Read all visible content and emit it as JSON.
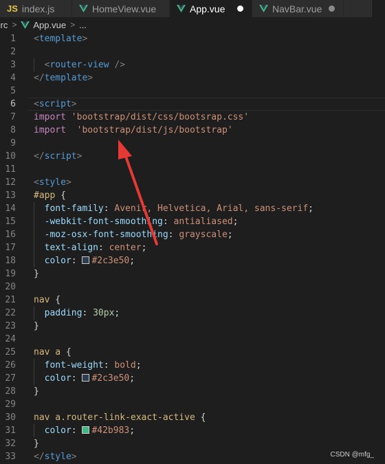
{
  "tabs": [
    {
      "label": "index.js",
      "icon": "js-icon",
      "state": "normal"
    },
    {
      "label": "HomeView.vue",
      "icon": "vue-icon",
      "state": "normal"
    },
    {
      "label": "App.vue",
      "icon": "vue-icon",
      "state": "active-modified"
    },
    {
      "label": "NavBar.vue",
      "icon": "vue-icon",
      "state": "modified"
    }
  ],
  "breadcrumb": {
    "folder": "src",
    "file": "App.vue",
    "symbol": "..."
  },
  "editor": {
    "current_line": 6,
    "lines": [
      {
        "n": "1",
        "tokens": [
          [
            "t-bracket",
            "<"
          ],
          [
            "t-tag",
            "template"
          ],
          [
            "t-bracket",
            ">"
          ]
        ]
      },
      {
        "n": "2",
        "tokens": []
      },
      {
        "n": "3",
        "tokens": [
          [
            "t-punc",
            "  "
          ],
          [
            "t-bracket",
            "<"
          ],
          [
            "t-tag",
            "router-view"
          ],
          [
            "t-bracket",
            " />"
          ]
        ]
      },
      {
        "n": "4",
        "tokens": [
          [
            "t-bracket",
            "</"
          ],
          [
            "t-tag",
            "template"
          ],
          [
            "t-bracket",
            ">"
          ]
        ]
      },
      {
        "n": "5",
        "tokens": []
      },
      {
        "n": "6",
        "tokens": [
          [
            "t-bracket",
            "<"
          ],
          [
            "t-tag",
            "script"
          ],
          [
            "t-bracket",
            ">"
          ]
        ]
      },
      {
        "n": "7",
        "tokens": [
          [
            "t-kw",
            "import"
          ],
          [
            "t-punc",
            " "
          ],
          [
            "t-str",
            "'bootstrap/dist/css/bootsrap.css'"
          ]
        ]
      },
      {
        "n": "8",
        "tokens": [
          [
            "t-kw",
            "import"
          ],
          [
            "t-punc",
            "  "
          ],
          [
            "t-str",
            "'bootstrap/dist/js/bootstrap'"
          ]
        ]
      },
      {
        "n": "9",
        "tokens": []
      },
      {
        "n": "10",
        "tokens": [
          [
            "t-bracket",
            "</"
          ],
          [
            "t-tag",
            "script"
          ],
          [
            "t-bracket",
            ">"
          ]
        ]
      },
      {
        "n": "11",
        "tokens": []
      },
      {
        "n": "12",
        "tokens": [
          [
            "t-bracket",
            "<"
          ],
          [
            "t-tag",
            "style"
          ],
          [
            "t-bracket",
            ">"
          ]
        ]
      },
      {
        "n": "13",
        "tokens": [
          [
            "t-sel",
            "#app"
          ],
          [
            "t-punc",
            " {"
          ]
        ]
      },
      {
        "n": "14",
        "tokens": [
          [
            "t-punc",
            "  "
          ],
          [
            "t-prop",
            "font-family"
          ],
          [
            "t-punc",
            ": "
          ],
          [
            "t-val",
            "Avenir, Helvetica, Arial, sans-serif"
          ],
          [
            "t-punc",
            ";"
          ]
        ]
      },
      {
        "n": "15",
        "tokens": [
          [
            "t-punc",
            "  "
          ],
          [
            "t-prop",
            "-webkit-font-smoothing"
          ],
          [
            "t-punc",
            ": "
          ],
          [
            "t-val",
            "antialiased"
          ],
          [
            "t-punc",
            ";"
          ]
        ]
      },
      {
        "n": "16",
        "tokens": [
          [
            "t-punc",
            "  "
          ],
          [
            "t-prop",
            "-moz-osx-font-smoothing"
          ],
          [
            "t-punc",
            ": "
          ],
          [
            "t-val",
            "grayscale"
          ],
          [
            "t-punc",
            ";"
          ]
        ]
      },
      {
        "n": "17",
        "tokens": [
          [
            "t-punc",
            "  "
          ],
          [
            "t-prop",
            "text-align"
          ],
          [
            "t-punc",
            ": "
          ],
          [
            "t-val",
            "center"
          ],
          [
            "t-punc",
            ";"
          ]
        ]
      },
      {
        "n": "18",
        "tokens": [
          [
            "t-punc",
            "  "
          ],
          [
            "t-prop",
            "color"
          ],
          [
            "t-punc",
            ": "
          ],
          [
            "swatch",
            "#2c3e50"
          ],
          [
            "t-val",
            "#2c3e50"
          ],
          [
            "t-punc",
            ";"
          ]
        ]
      },
      {
        "n": "19",
        "tokens": [
          [
            "t-punc",
            "}"
          ]
        ]
      },
      {
        "n": "20",
        "tokens": []
      },
      {
        "n": "21",
        "tokens": [
          [
            "t-sel",
            "nav"
          ],
          [
            "t-punc",
            " {"
          ]
        ]
      },
      {
        "n": "22",
        "tokens": [
          [
            "t-punc",
            "  "
          ],
          [
            "t-prop",
            "padding"
          ],
          [
            "t-punc",
            ": "
          ],
          [
            "t-num",
            "30px"
          ],
          [
            "t-punc",
            ";"
          ]
        ]
      },
      {
        "n": "23",
        "tokens": [
          [
            "t-punc",
            "}"
          ]
        ]
      },
      {
        "n": "24",
        "tokens": []
      },
      {
        "n": "25",
        "tokens": [
          [
            "t-sel",
            "nav a"
          ],
          [
            "t-punc",
            " {"
          ]
        ]
      },
      {
        "n": "26",
        "tokens": [
          [
            "t-punc",
            "  "
          ],
          [
            "t-prop",
            "font-weight"
          ],
          [
            "t-punc",
            ": "
          ],
          [
            "t-val",
            "bold"
          ],
          [
            "t-punc",
            ";"
          ]
        ]
      },
      {
        "n": "27",
        "tokens": [
          [
            "t-punc",
            "  "
          ],
          [
            "t-prop",
            "color"
          ],
          [
            "t-punc",
            ": "
          ],
          [
            "swatch",
            "#2c3e50"
          ],
          [
            "t-val",
            "#2c3e50"
          ],
          [
            "t-punc",
            ";"
          ]
        ]
      },
      {
        "n": "28",
        "tokens": [
          [
            "t-punc",
            "}"
          ]
        ]
      },
      {
        "n": "29",
        "tokens": []
      },
      {
        "n": "30",
        "tokens": [
          [
            "t-sel",
            "nav a.router-link-exact-active"
          ],
          [
            "t-punc",
            " {"
          ]
        ]
      },
      {
        "n": "31",
        "tokens": [
          [
            "t-punc",
            "  "
          ],
          [
            "t-prop",
            "color"
          ],
          [
            "t-punc",
            ": "
          ],
          [
            "swatch",
            "#42b983"
          ],
          [
            "t-val",
            "#42b983"
          ],
          [
            "t-punc",
            ";"
          ]
        ]
      },
      {
        "n": "32",
        "tokens": [
          [
            "t-punc",
            "}"
          ]
        ]
      },
      {
        "n": "33",
        "tokens": [
          [
            "t-bracket",
            "</"
          ],
          [
            "t-tag",
            "style"
          ],
          [
            "t-bracket",
            ">"
          ]
        ]
      }
    ]
  },
  "watermark": "CSDN @mfg_",
  "colors": {
    "vue_green": "#41b883",
    "arrow_red": "#e53935",
    "js_yellow": "#e8c34a"
  }
}
